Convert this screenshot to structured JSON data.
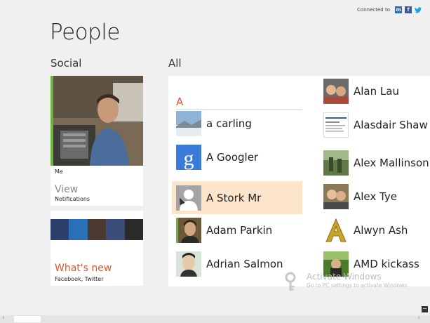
{
  "header": {
    "connected_label": "Connected to",
    "services": [
      {
        "name": "messenger",
        "glyph": "m",
        "color": "#2d6bb4"
      },
      {
        "name": "facebook",
        "glyph": "f",
        "color": "#3b5998"
      },
      {
        "name": "twitter",
        "glyph": "🐦",
        "color": "#1da1f2"
      }
    ]
  },
  "page": {
    "title": "People"
  },
  "social": {
    "label": "Social",
    "me_tile": {
      "name": "Me",
      "view_label": "View",
      "notifications_label": "Notifications"
    },
    "whats_new_tile": {
      "title": "What's new",
      "sources": "Facebook, Twitter"
    }
  },
  "all": {
    "label": "All",
    "group_letter": "A",
    "contacts_col1": [
      {
        "name": "a carling",
        "avatar": "landscape"
      },
      {
        "name": "A Googler",
        "avatar": "google-g"
      },
      {
        "name": "A Stork Mr",
        "avatar": "default-silhouette",
        "selected": true
      },
      {
        "name": "Adam Parkin",
        "avatar": "person-photo"
      },
      {
        "name": "Adrian Salmon",
        "avatar": "cartoon"
      }
    ],
    "contacts_col2": [
      {
        "name": "Alan Lau",
        "avatar": "people-photo"
      },
      {
        "name": "Alasdair Shaw",
        "avatar": "document-page"
      },
      {
        "name": "Alex Mallinson",
        "avatar": "outdoor-photo"
      },
      {
        "name": "Alex Tye",
        "avatar": "people-photo"
      },
      {
        "name": "Alwyn Ash",
        "avatar": "gold-letter-a"
      },
      {
        "name": "AMD kickass",
        "avatar": "green-photo"
      }
    ]
  },
  "watermark": {
    "title": "Activate Windows",
    "subtitle": "Go to PC settings to activate Windows."
  },
  "colors": {
    "accent": "#e0542c",
    "selection": "#fde5cc",
    "me_bar": "#6db33f"
  }
}
